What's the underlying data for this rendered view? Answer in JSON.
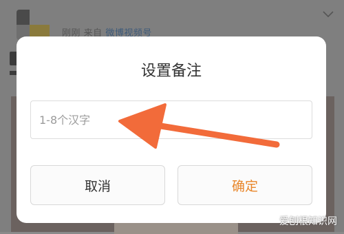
{
  "background_feed": {
    "meta_time": "刚刚",
    "meta_from": "来自",
    "meta_source": "微博视频号"
  },
  "dialog": {
    "title": "设置备注",
    "input": {
      "placeholder": "1-8个汉字",
      "value": ""
    },
    "cancel_label": "取消",
    "confirm_label": "确定"
  },
  "watermark": "爱刨根知识网",
  "colors": {
    "confirm_text": "#e8862a",
    "annotation_arrow": "#f26b3a",
    "overlay": "#7f7f7f"
  },
  "icons": {
    "chevron": "chevron-down-icon",
    "arrow": "annotation-arrow-icon"
  }
}
